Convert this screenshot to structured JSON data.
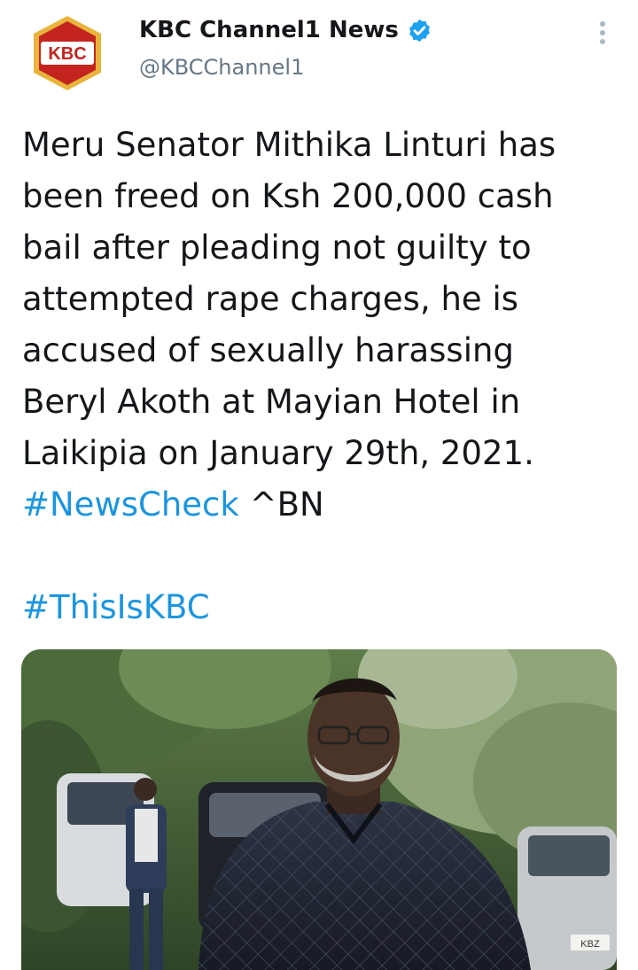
{
  "account": {
    "display_name": "KBC Channel1 News",
    "handle": "@KBCChannel1",
    "verified": true,
    "avatar_text": "KBC",
    "verified_icon": "verified-badge-icon",
    "more_icon": "more-vertical-icon"
  },
  "tweet": {
    "text_line_1": "Meru Senator Mithika Linturi has",
    "text_line_2": "been freed on Ksh 200,000 cash",
    "text_line_3": "bail after pleading not guilty to",
    "text_line_4": "attempted rape charges, he is",
    "text_line_5": "accused of sexually harassing",
    "text_line_6": "Beryl Akoth at Mayian Hotel in",
    "text_line_7": "Laikipia on January 29th, 2021.",
    "hashtag_1": "#NewsCheck",
    "suffix": " ^BN",
    "hashtag_2": "#ThisIsKBC"
  },
  "media": {
    "plate_text": "KBZ"
  },
  "colors": {
    "link": "#1b95e0",
    "verified": "#1da1f2",
    "handle": "#657786",
    "avatar_red": "#c4241e",
    "avatar_gold": "#e8b43c"
  }
}
